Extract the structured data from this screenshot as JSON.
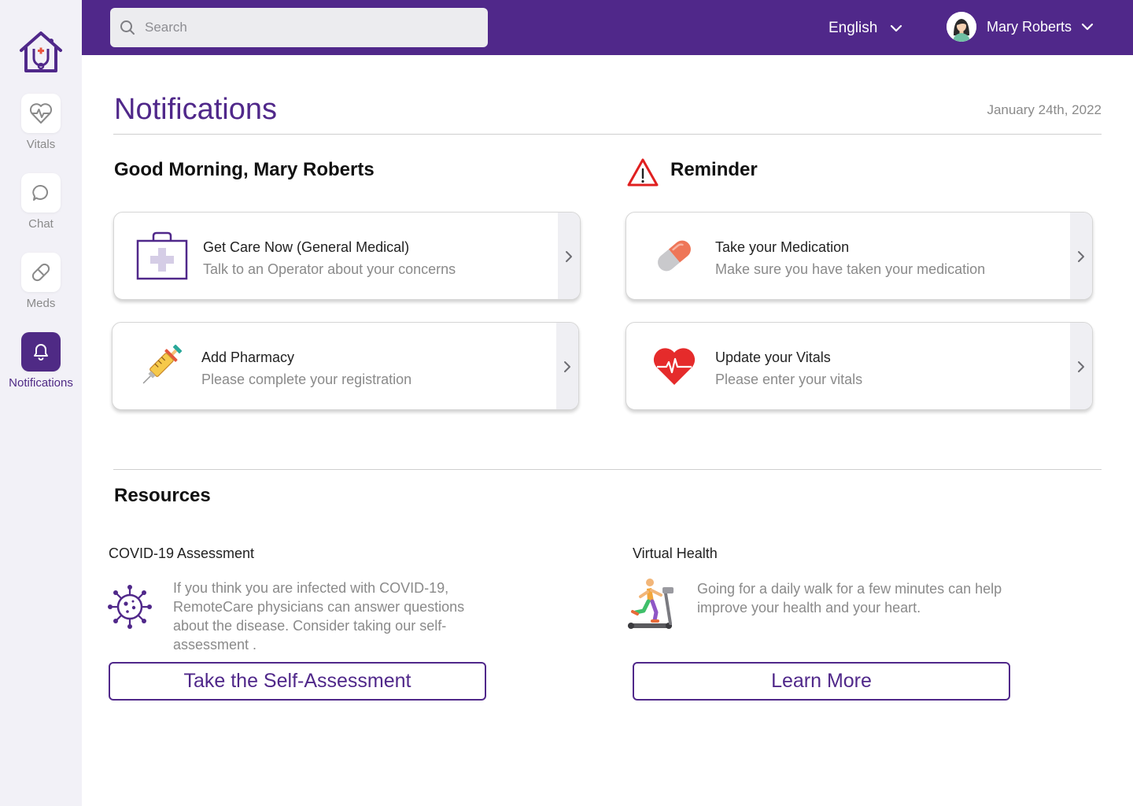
{
  "sidebar": {
    "items": [
      {
        "label": "Vitals",
        "icon": "heart-pulse-icon",
        "active": false
      },
      {
        "label": "Chat",
        "icon": "chat-icon",
        "active": false
      },
      {
        "label": "Meds",
        "icon": "pill-icon",
        "active": false
      },
      {
        "label": "Notifications",
        "icon": "bell-icon",
        "active": true
      }
    ]
  },
  "topbar": {
    "search_placeholder": "Search",
    "language": "English",
    "user_name": "Mary Roberts"
  },
  "header": {
    "title": "Notifications",
    "date": "January 24th, 2022"
  },
  "greeting": "Good Morning, Mary Roberts",
  "reminder_title": "Reminder",
  "cards": [
    {
      "title": "Get Care Now (General Medical)",
      "subtitle": "Talk to an Operator about your concerns",
      "icon": "medical-kit-icon"
    },
    {
      "title": "Add Pharmacy",
      "subtitle": "Please complete your registration",
      "icon": "syringe-icon"
    },
    {
      "title": "Take your Medication",
      "subtitle": "Make sure you have taken your medication",
      "icon": "capsule-icon"
    },
    {
      "title": "Update your Vitals",
      "subtitle": "Please enter your vitals",
      "icon": "heart-rate-icon"
    }
  ],
  "resources": {
    "title": "Resources",
    "items": [
      {
        "heading": "COVID-19 Assessment",
        "text": "If you think you are infected with COVID-19, RemoteCare physicians can answer questions about the disease. Consider taking our self-assessment .",
        "button": "Take the Self-Assessment",
        "icon": "virus-icon"
      },
      {
        "heading": "Virtual Health",
        "text": "Going for a daily walk for a few minutes can help improve your health and your heart.",
        "button": "Learn More",
        "icon": "treadmill-icon"
      }
    ]
  },
  "colors": {
    "brand": "#50288a",
    "sidebar_bg": "#f2f1f7",
    "alert_red": "#e02020"
  }
}
